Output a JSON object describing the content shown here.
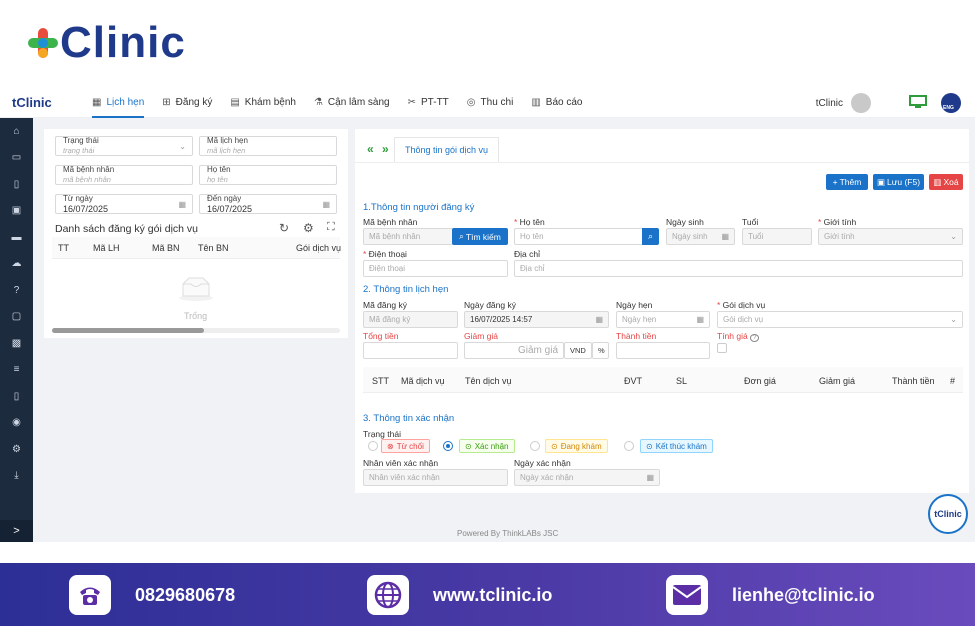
{
  "brand": {
    "logo_text": "Clinic",
    "small_logo": "tClinic"
  },
  "nav": {
    "items": [
      {
        "icon": "calendar-icon",
        "label": "Lịch hẹn"
      },
      {
        "icon": "plus-square-icon",
        "label": "Đăng ký"
      },
      {
        "icon": "clipboard-icon",
        "label": "Khám bệnh"
      },
      {
        "icon": "flask-icon",
        "label": "Cận lâm sàng"
      },
      {
        "icon": "scissors-icon",
        "label": "PT-TT"
      },
      {
        "icon": "coin-icon",
        "label": "Thu chi"
      },
      {
        "icon": "bar-chart-icon",
        "label": "Báo cáo"
      }
    ],
    "user_name": "tClinic",
    "flag_text": "ENG"
  },
  "sidebar": {
    "icons": [
      "home-icon",
      "id-card-icon",
      "document-icon",
      "inbox-icon",
      "list-icon",
      "cloud-upload-icon",
      "help-icon",
      "id-badge-icon",
      "cash-icon",
      "bulleted-list-icon",
      "file-icon",
      "user-circle-icon",
      "settings-icon",
      "download-icon"
    ],
    "expand_icon": ">"
  },
  "filters": {
    "status": {
      "label": "Trạng thái",
      "placeholder": "trạng thái"
    },
    "appointment_code": {
      "label": "Mã lịch hẹn",
      "placeholder": "mã lịch hẹn"
    },
    "patient_code": {
      "label": "Mã bệnh nhân",
      "placeholder": "mã bệnh nhân"
    },
    "name": {
      "label": "Họ tên",
      "placeholder": "họ tên"
    },
    "from_date": {
      "label": "Từ ngày",
      "value": "16/07/2025"
    },
    "to_date": {
      "label": "Đến ngày",
      "value": "16/07/2025"
    }
  },
  "list": {
    "title": "Danh sách đăng ký gói dịch vụ",
    "columns": [
      "TT",
      "Mã LH",
      "Mã BN",
      "Tên BN",
      "Gói dịch vụ"
    ],
    "empty_text": "Trống"
  },
  "form": {
    "tab_label": "Thông tin gói dịch vụ",
    "buttons": {
      "add": "Thêm",
      "save": "Lưu (F5)",
      "delete": "Xoá"
    },
    "section1": {
      "title": "1.Thông tin người đăng ký",
      "patient_code_label": "Mã bệnh nhân",
      "patient_code_placeholder": "Mã bệnh nhân",
      "search_button": "Tìm kiếm",
      "name_label": "Họ tên",
      "name_placeholder": "Họ tên",
      "dob_label": "Ngày sinh",
      "dob_placeholder": "Ngày sinh",
      "age_label": "Tuổi",
      "age_placeholder": "Tuổi",
      "gender_label": "Giới tính",
      "gender_placeholder": "Giới tính",
      "phone_label": "Điện thoại",
      "phone_placeholder": "Điện thoại",
      "address_label": "Địa chỉ",
      "address_placeholder": "Địa chỉ"
    },
    "section2": {
      "title": "2. Thông tin lịch hẹn",
      "reg_code_label": "Mã đăng ký",
      "reg_code_placeholder": "Mã đăng ký",
      "reg_date_label": "Ngày đăng ký",
      "reg_date_value": "16/07/2025 14:57",
      "appt_date_label": "Ngày hẹn",
      "appt_date_placeholder": "Ngày hẹn",
      "package_label": "Gói dịch vụ",
      "package_placeholder": "Gói dịch vụ",
      "total_label": "Tổng tiền",
      "discount_label": "Giảm giá",
      "discount_placeholder": "Giảm giá",
      "unit_vnd": "VND",
      "unit_pct": "%",
      "final_label": "Thành tiền",
      "calc_label": "Tính giá",
      "table_columns": [
        "STT",
        "Mã dịch vụ",
        "Tên dịch vụ",
        "ĐVT",
        "SL",
        "Đơn giá",
        "Giảm giá",
        "Thành tiền",
        "#"
      ]
    },
    "section3": {
      "title": "3. Thông tin xác nhận",
      "status_label": "Trạng thái",
      "statuses": [
        "Từ chối",
        "Xác nhận",
        "Đang khám",
        "Kết thúc khám"
      ],
      "confirmer_label": "Nhân viên xác nhận",
      "confirmer_placeholder": "Nhân viên xác nhận",
      "confirm_date_label": "Ngày xác nhận",
      "confirm_date_placeholder": "Ngày xác nhận"
    }
  },
  "powered_by": "Powered By ThinkLABs JSC",
  "float_badge": "tClinic",
  "contact": {
    "phone": "0829680678",
    "website": "www.tclinic.io",
    "email": "lienhe@tclinic.io"
  },
  "colors": {
    "accent": "#1a73c8",
    "sidebar": "#1d2b3e",
    "danger": "#e64545",
    "brand_navy": "#1f3a8a"
  }
}
